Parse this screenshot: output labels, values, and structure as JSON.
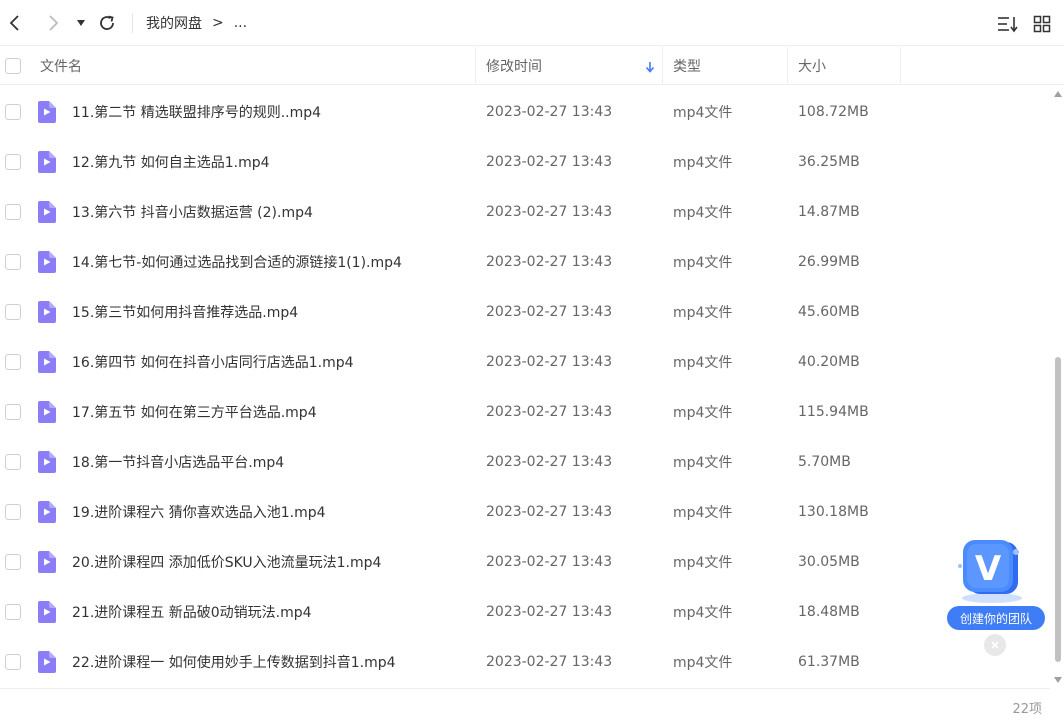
{
  "breadcrumb": {
    "root": "我的网盘",
    "separator": ">",
    "ellipsis": "..."
  },
  "columns": {
    "name": "文件名",
    "modified": "修改时间",
    "type": "类型",
    "size": "大小"
  },
  "sort": {
    "column": "modified",
    "direction": "desc"
  },
  "files": [
    {
      "name": "11.第二节 精选联盟排序号的规则..mp4",
      "time": "2023-02-27 13:43",
      "type": "mp4文件",
      "size": "108.72MB"
    },
    {
      "name": "12.第九节 如何自主选品1.mp4",
      "time": "2023-02-27 13:43",
      "type": "mp4文件",
      "size": "36.25MB"
    },
    {
      "name": "13.第六节 抖音小店数据运营 (2).mp4",
      "time": "2023-02-27 13:43",
      "type": "mp4文件",
      "size": "14.87MB"
    },
    {
      "name": "14.第七节-如何通过选品找到合适的源链接1(1).mp4",
      "time": "2023-02-27 13:43",
      "type": "mp4文件",
      "size": "26.99MB"
    },
    {
      "name": "15.第三节如何用抖音推荐选品.mp4",
      "time": "2023-02-27 13:43",
      "type": "mp4文件",
      "size": "45.60MB"
    },
    {
      "name": "16.第四节 如何在抖音小店同行店选品1.mp4",
      "time": "2023-02-27 13:43",
      "type": "mp4文件",
      "size": "40.20MB"
    },
    {
      "name": "17.第五节 如何在第三方平台选品.mp4",
      "time": "2023-02-27 13:43",
      "type": "mp4文件",
      "size": "115.94MB"
    },
    {
      "name": "18.第一节抖音小店选品平台.mp4",
      "time": "2023-02-27 13:43",
      "type": "mp4文件",
      "size": "5.70MB"
    },
    {
      "name": "19.进阶课程六 猜你喜欢选品入池1.mp4",
      "time": "2023-02-27 13:43",
      "type": "mp4文件",
      "size": "130.18MB"
    },
    {
      "name": "20.进阶课程四 添加低价SKU入池流量玩法1.mp4",
      "time": "2023-02-27 13:43",
      "type": "mp4文件",
      "size": "30.05MB"
    },
    {
      "name": "21.进阶课程五 新品破0动销玩法.mp4",
      "time": "2023-02-27 13:43",
      "type": "mp4文件",
      "size": "18.48MB"
    },
    {
      "name": "22.进阶课程一 如何使用妙手上传数据到抖音1.mp4",
      "time": "2023-02-27 13:43",
      "type": "mp4文件",
      "size": "61.37MB"
    }
  ],
  "footer": {
    "count": "22项"
  },
  "team_widget": {
    "label": "创建你的团队",
    "logo_letter": "V"
  },
  "colors": {
    "accent": "#3f7df6",
    "file_icon": "#8b7cf8",
    "text": "#333333",
    "muted": "#666666"
  }
}
